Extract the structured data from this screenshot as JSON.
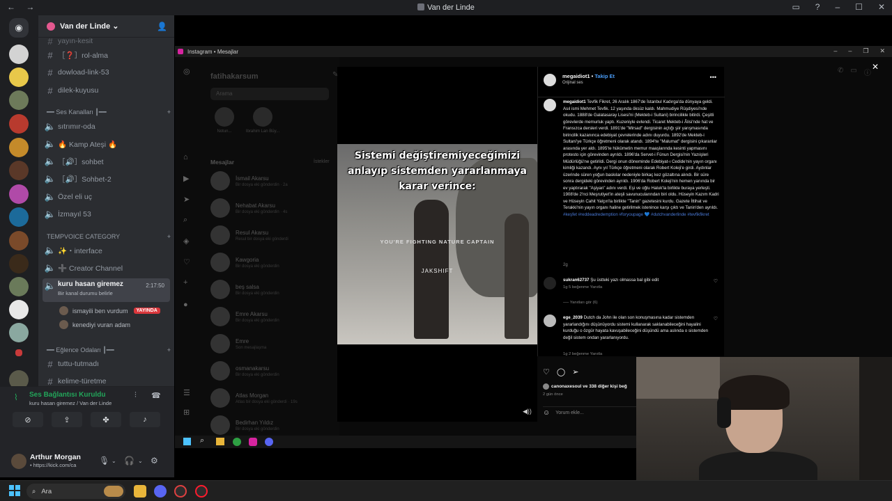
{
  "window_title": "Van der Linde",
  "discord": {
    "server_name": "Van der Linde",
    "channels": [
      {
        "type": "text",
        "name": "yayın-kesit"
      },
      {
        "type": "text",
        "name": "［❓］rol-alma"
      },
      {
        "type": "text",
        "name": "dowload-link-53"
      },
      {
        "type": "text",
        "name": "dilek-kuyusu"
      }
    ],
    "cat_voice": "━━ Ses Kanalları ┃━━",
    "voice_channels": [
      {
        "name": "sıtrımır-oda"
      },
      {
        "name": "🔥 Kamp Ateşi 🔥"
      },
      {
        "name": "［🔊］sohbet"
      },
      {
        "name": "［🔊］Sohbet-2"
      },
      {
        "name": "Özel eli uç"
      },
      {
        "name": "İzmayıl 53"
      }
    ],
    "cat_temp": "TEMPVOICE CATEGORY",
    "temp_channels": [
      {
        "name": "✨・interface"
      },
      {
        "name": "➕ Creator Channel"
      }
    ],
    "active_channel": {
      "name": "kuru hasan giremez",
      "timer": "2:17:50",
      "status": "Bir kanal durumu belirle"
    },
    "voice_users": [
      {
        "name": "ismayili ben vurdum",
        "badge": "YAYINDA"
      },
      {
        "name": "kenediyi vuran adam"
      }
    ],
    "cat_fun": "━━ Eğlence Odaları ┃━━",
    "fun_channels": [
      {
        "name": "tuttu-tutmadı"
      },
      {
        "name": "kelime-türetme"
      }
    ],
    "voice_status": {
      "title": "Ses Bağlantısı Kuruldu",
      "sub": "kuru hasan giremez / Van der Linde"
    },
    "user": {
      "name": "Arthur Morgan",
      "sub": "• https://kick.com/ca"
    }
  },
  "instagram": {
    "window_title": "Instagram • Mesajlar",
    "username": "fatihakarsum",
    "search_placeholder": "Arama",
    "messages_heading": "Mesajlar",
    "requests": "İstekler",
    "notes": [
      {
        "name": "Notun...",
        "sub": "Bir şeyler paylaş"
      },
      {
        "name": "Ibrahim Lan Büy..."
      }
    ],
    "threads": [
      {
        "name": "İsmail Akarsu",
        "sub": "Bir dosya eki gönderdin · 2a"
      },
      {
        "name": "Nehabat Akarsu",
        "sub": "Bir dosya eki gönderdin · 4s"
      },
      {
        "name": "Resul Akarsu",
        "sub": "Resul bir dosya eki gönderdi"
      },
      {
        "name": "Kawgoria",
        "sub": "Bir dosya eki gönderdin"
      },
      {
        "name": "beş salsa",
        "sub": "Bir dosya eki gönderdin"
      },
      {
        "name": "Emre Akarsu",
        "sub": "Bir dosya eki gönderdin"
      },
      {
        "name": "Emre",
        "sub": "Son mesajlaşma"
      },
      {
        "name": "osmanakarsu",
        "sub": "Bir dosya eki gönderdin"
      },
      {
        "name": "Atlas Morgan",
        "sub": "Atlas bir dosya eki gönderdi · 19s"
      },
      {
        "name": "Bedirhan Yıldız",
        "sub": "Bir dosya eki gönderdin"
      }
    ],
    "post": {
      "video_caption": "Sistemi değiştiremiyeceğimizi anlayıp sistemden yararlanmaya karar verince:",
      "video_sub": "YOU'RE FIGHTING NATURE CAPTAIN",
      "video_watermark": "JAKSHIFT",
      "author": "megaidiot1",
      "follow": "Takip Et",
      "audio": "Orijinal ses",
      "caption_author": "megaidiot1",
      "caption": "Tevfik Fikret, 26 Aralık 1867'de İstanbul Kadırga'da dünyaya geldi. Asıl ismi Mehmet Tevfik. 12 yaşında öksüz kaldı. Mahmudiye Rüşdiyesi'nde okudu. 1888'de Galatasaray Lisesi'ni (Mekteb-i Sultani) birincilikle bitirdi. Çeşitli görevlerde memurluk yaptı. Kuzeniyle evlendi. Ticaret Mekteb-i Âlisi'nde hat ve Fransızca dersleri verdi. 1891'de \"Mirsad\" dergisinin açtığı şiir yarışmasında birincilik kazanınca edebiyat çevrelerinde adını duyurdu. 1892'de Mekteb-i Sultani'ye Türkçe öğretmeni olarak atandı. 1894'te \"Malumat\" dergisini çıkaranlar arasında yer aldı. 1895'te hükümetin memur maaşlarında kesinti yapmasını protesto için görevinden ayrıldı. 1896'da Servet-i Fünun Dergisi'nin Yazıişleri Müdürlüğü'ne getirildi. Dergi onun döneminde Edebiyat-ı Cedide'nin yayın organı kimliği kazandı. Aynı yıl Türkçe öğretmeni olarak Robert Koleji'e girdi. Aydınlar üzerinde süren yoğun baskılar nedeniyle birkaç kez gözaltına alındı. Bir süre sonra dergideki görevinden ayrıldı. 1906'da Robert Koleji'nin hemen yanında bir ev yaptırarak \"Aşiyan\" adını verdi. Eşi ve oğlu Haluk'la birlikte buraya yerleşti. 1908'de 2'nci Meşrutiyet'in ateşli savunucularından biri oldu. Hüseyin Kazım Kadri ve Hüseyin Cahit Yalçın'la birlikte \"Tanin\" gazetesini kurdu. Gazete İttihat ve Terakki'nin yayın organı haline getirilmek istenince karşı çıktı ve Tanin'den ayrıldı.",
      "tags": "#keşfet #reddeadredemption #foryoupage 💙 #dutchvanderlinde #tevfikfikret",
      "caption_time": "2g",
      "comments": [
        {
          "user": "sukran62737",
          "text": "Şu üstteki yazı olmassa bal gibi edit",
          "meta": "1g   5 beğenme   Yanıtla",
          "replies": "Yanıtları gör (6)"
        },
        {
          "user": "ege_2039",
          "text": "Dutch da John ile olan son konuşmasına kadar sistemden yararlandığını düşünüyordu sistemi kullanarak saklanabileceğini hayalini kurduğu o özgür hayata kavuşabileceğini düşündü ama aslında o sistemden değil sistem ondan yararlanıyordu.",
          "meta": "1g   2 beğenme   Yanıtla"
        }
      ],
      "likes": "canonaxesoul ve 338 diğer kişi beğ",
      "date": "2 gün önce",
      "comment_placeholder": "Yorum ekle..."
    }
  },
  "taskbar": {
    "search": "Ara"
  }
}
